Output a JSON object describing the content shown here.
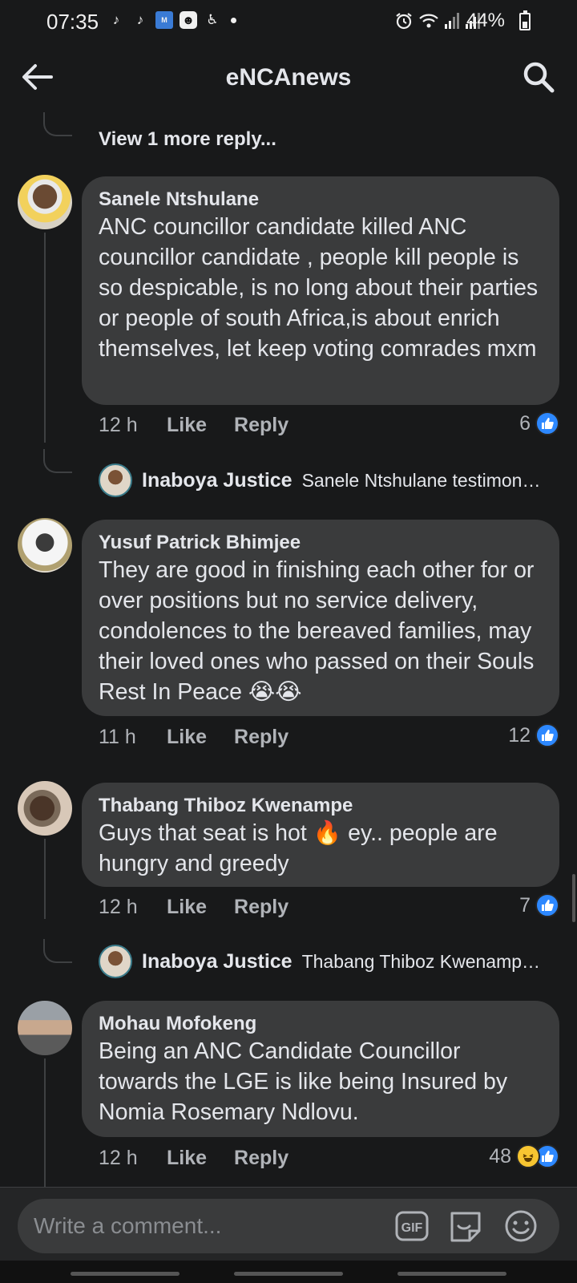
{
  "status_bar": {
    "time": "07:35",
    "battery": "44%",
    "icons_left": [
      "tiktok-icon",
      "tiktok-icon",
      "mnet-icon",
      "gallery-icon",
      "accessibility-icon",
      "dot-icon"
    ],
    "icons_right": [
      "alarm-icon",
      "wifi-icon",
      "signal-icon",
      "signal-icon",
      "battery-icon"
    ]
  },
  "header": {
    "title": "eNCAnews"
  },
  "thread": {
    "view_more": "View 1 more reply..."
  },
  "comments": [
    {
      "author": "Sanele Ntshulane",
      "text": "ANC councillor candidate killed ANC councillor candidate , people kill people is so despicable, is no long about their parties or people of south Africa,is about enrich themselves, let keep voting comrades mxm",
      "time": "12 h",
      "like": "Like",
      "reply": "Reply",
      "reaction_count": "6",
      "reply_preview": {
        "name": "Inaboya Justice",
        "text": "Sanele Ntshulane testimon…"
      }
    },
    {
      "author": "Yusuf Patrick Bhimjee",
      "text": "They are good in finishing each other for or over positions but no service delivery, condolences to the bereaved families, may their loved ones who passed on their Souls Rest In Peace 😭😭",
      "time": "11 h",
      "like": "Like",
      "reply": "Reply",
      "reaction_count": "12"
    },
    {
      "author": "Thabang Thiboz Kwenampe",
      "text": "Guys that seat is hot 🔥 ey.. people are hungry and greedy",
      "time": "12 h",
      "like": "Like",
      "reply": "Reply",
      "reaction_count": "7",
      "reply_preview": {
        "name": "Inaboya Justice",
        "text": "Thabang Thiboz Kwenamp…"
      }
    },
    {
      "author": "Mohau Mofokeng",
      "text": "Being an ANC Candidate Councillor towards the LGE is like being Insured by Nomia Rosemary Ndlovu.",
      "time": "12 h",
      "like": "Like",
      "reply": "Reply",
      "reaction_count": "48"
    }
  ],
  "composer": {
    "placeholder": "Write a comment..."
  },
  "colors": {
    "background": "#18191a",
    "bubble": "#3a3b3c",
    "text": "#e4e6eb",
    "muted": "#b0b3b8",
    "like_blue": "#2d88ff"
  }
}
